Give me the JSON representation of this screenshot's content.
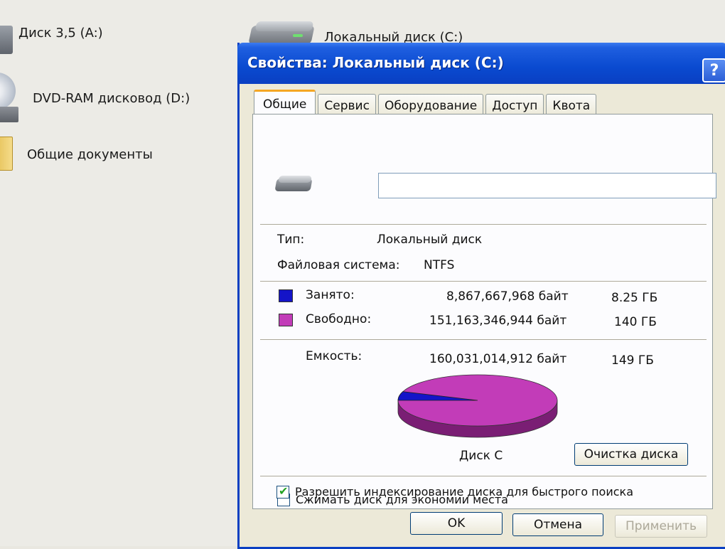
{
  "desktop": {
    "items": [
      {
        "label": "Диск 3,5 (A:)"
      },
      {
        "label": "DVD-RAM дисковод (D:)"
      },
      {
        "label": "Общие документы"
      },
      {
        "label": "Локальный диск (C:)"
      }
    ]
  },
  "dialog": {
    "title": "Свойства: Локальный диск (C:)",
    "help": "?",
    "tabs": [
      {
        "label": "Общие"
      },
      {
        "label": "Сервис"
      },
      {
        "label": "Оборудование"
      },
      {
        "label": "Доступ"
      },
      {
        "label": "Квота"
      }
    ],
    "volume_label_value": "",
    "type_label": "Тип:",
    "type_value": "Локальный диск",
    "fs_label": "Файловая система:",
    "fs_value": "NTFS",
    "used_label": "Занято:",
    "used_bytes": "8,867,667,968 байт",
    "used_gb": "8.25 ГБ",
    "free_label": "Свободно:",
    "free_bytes": "151,163,346,944 байт",
    "free_gb": "140 ГБ",
    "capacity_label": "Емкость:",
    "capacity_bytes": "160,031,014,912 байт",
    "capacity_gb": "149 ГБ",
    "disk_name": "Диск C",
    "cleanup_button": "Очистка диска",
    "compress_label": "Сжимать диск для экономии места",
    "compress_checked": false,
    "index_label": "Разрешить индексирование диска для быстрого поиска",
    "index_checked": true,
    "ok_button": "OK",
    "cancel_button": "Отмена",
    "apply_button": "Применить",
    "colors": {
      "used": "#1414c8",
      "free": "#c23cb8",
      "free_side": "#7a1e74",
      "used_side": "#0a0a70"
    },
    "usage": {
      "used_fraction": 0.0554,
      "free_fraction": 0.9446
    }
  }
}
